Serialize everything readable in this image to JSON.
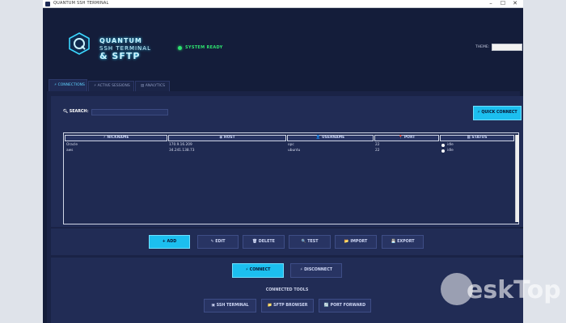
{
  "window": {
    "title": "QUANTUM SSH TERMINAL",
    "controls": [
      "–",
      "☐",
      "✕"
    ]
  },
  "logo": {
    "line1": "QUANTUM",
    "line2": "SSH TERMINAL",
    "line3": "& SFTP"
  },
  "status": {
    "text": "SYSTEM READY",
    "color": "#2ee36f"
  },
  "theme": {
    "label": "THEME:",
    "value": ""
  },
  "tabs": [
    {
      "icon": "⚡",
      "label": "CONNECTIONS"
    },
    {
      "icon": "⚡",
      "label": "ACTIVE SESSIONS"
    },
    {
      "icon": "▤",
      "label": "ANALYTICS"
    }
  ],
  "search": {
    "label": "SEARCH:",
    "value": ""
  },
  "quick_connect": {
    "icon": "⚡",
    "label": "QUICK CONNECT"
  },
  "table": {
    "columns": [
      {
        "icon": "⚡",
        "label": "NICKNAME"
      },
      {
        "icon": "◉",
        "label": "HOST"
      },
      {
        "icon": "👤",
        "label": "USERNAME"
      },
      {
        "icon": "📍",
        "label": "PORT"
      },
      {
        "icon": "▦",
        "label": "STATUS"
      }
    ],
    "rows": [
      {
        "nickname": "Oracle",
        "host": "170.9.16.209",
        "username": "opc",
        "port": "22",
        "status": "idle"
      },
      {
        "nickname": "aws",
        "host": "34.241.138.73",
        "username": "ubuntu",
        "port": "22",
        "status": "idle"
      }
    ]
  },
  "actions": [
    {
      "icon": "+",
      "label": "ADD"
    },
    {
      "icon": "✎",
      "label": "EDIT"
    },
    {
      "icon": "🗑",
      "label": "DELETE"
    },
    {
      "icon": "🔍",
      "label": "TEST"
    },
    {
      "icon": "📂",
      "label": "IMPORT"
    },
    {
      "icon": "💾",
      "label": "EXPORT"
    }
  ],
  "connection": {
    "connect": {
      "icon": "⚡",
      "label": "CONNECT"
    },
    "disconnect": {
      "icon": "⚡",
      "label": "DISCONNECT"
    }
  },
  "tools": {
    "title": "CONNECTED TOOLS",
    "buttons": [
      {
        "icon": "▣",
        "label": "SSH TERMINAL"
      },
      {
        "icon": "📁",
        "label": "SFTP BROWSER"
      },
      {
        "icon": "🔄",
        "label": "PORT FORWARD"
      }
    ]
  },
  "watermark": {
    "text": "eskTop"
  },
  "colors": {
    "accent": "#1cbfef",
    "bg": "#141d3a",
    "panel": "#212c55"
  }
}
